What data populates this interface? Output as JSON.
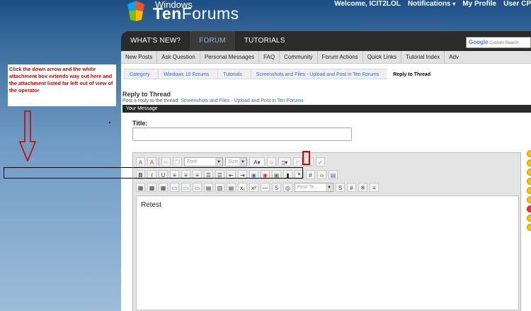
{
  "logo": {
    "windows": "Windows",
    "ten": "Ten",
    "forums": "Forums"
  },
  "topnav": {
    "welcome": "Welcome,",
    "username": "ICIT2LOL",
    "notifications": "Notifications",
    "profile": "My Profile",
    "user_cp": "User CP"
  },
  "tabs": [
    "WHAT'S NEW?",
    "FORUM",
    "TUTORIALS"
  ],
  "search": {
    "brand": "Google",
    "placeholder": "Custom Search"
  },
  "subnav": [
    "New Posts",
    "Ask Question",
    "Personal Messages",
    "FAQ",
    "Community",
    "Forum Actions",
    "Quick Links",
    "Tutorial Index",
    "Adv"
  ],
  "subnav_dropdowns": [
    "Community",
    "Forum Actions",
    "Quick Links"
  ],
  "breadcrumb": [
    "Category",
    "Windows 10 Forums",
    "Tutorials",
    "Screenshots and Files - Upload and Post in Ten Forums",
    "Reply to Thread"
  ],
  "reply": {
    "title": "Reply to Thread",
    "subtitle_prefix": "Post a reply to the thread:",
    "thread_link": "Screenshots and Files - Upload and Post in Ten Forums"
  },
  "message_bar": "Your Message",
  "title_label": "Title:",
  "title_value": "",
  "editor": {
    "font_select": "Font",
    "size_select": "Size",
    "post_template": "Post Te...",
    "content": "Retest"
  },
  "annotation": {
    "note": "Click the down arrow and the white attachment box extends way out here and the attachment listed far left out of view of the operator",
    "note_color": "#d00000",
    "highlight_color": "#dd0000"
  },
  "colors": {
    "nav_bg": "#2b2b2b",
    "link": "#3366cc",
    "active_tab": "#8fb3d9"
  }
}
